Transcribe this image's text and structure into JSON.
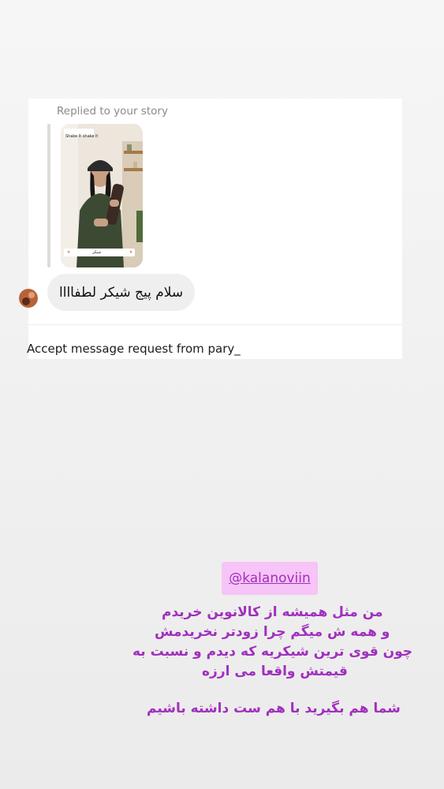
{
  "dm": {
    "replied_label": "Replied to your story",
    "story_thumbnail": {
      "top_text": "Shake It shake it",
      "bottom_text": "شیکر"
    },
    "message": "سلام پیج شیکر لطفاااا",
    "accept_request": "Accept message request from pary_"
  },
  "overlay": {
    "mention": "@kalanoviin",
    "lines": [
      "من مثل همیشه از کالانوین خریدم",
      "و همه ش میگم چرا زودتر نخریدمش",
      "چون قوی ترین شیکریه که دیدم و نسبت به",
      "قیمتش واقعا می ارزه",
      "شما هم بگیرید با هم ست داشته باشیم"
    ],
    "text_color": "#a12fbe",
    "mention_bg": "#f6c4f6"
  }
}
